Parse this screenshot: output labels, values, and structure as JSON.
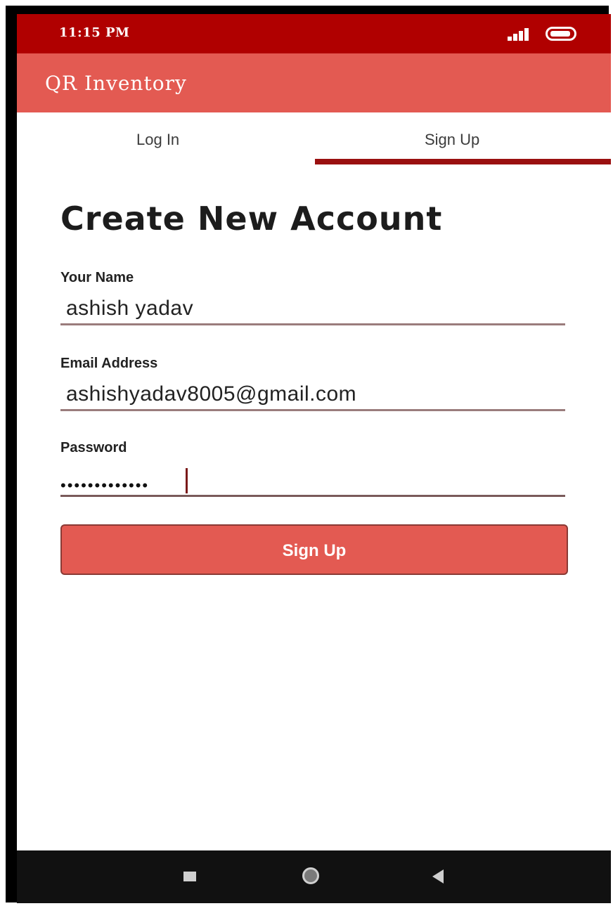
{
  "status_bar": {
    "time": "11:15 PM"
  },
  "app_bar": {
    "title": "QR Inventory"
  },
  "tabs": [
    {
      "label": "Log In",
      "selected": false
    },
    {
      "label": "Sign Up",
      "selected": true
    }
  ],
  "form": {
    "heading": "Create New Account",
    "name_label": "Your Name",
    "name_value": "ashish yadav",
    "email_label": "Email Address",
    "email_value": "ashishyadav8005@gmail.com",
    "password_label": "Password",
    "password_masked": "•••••••••••••",
    "submit_label": "Sign Up"
  },
  "nav_bar": {
    "icons": [
      "recents-icon",
      "home-icon",
      "back-icon"
    ]
  },
  "colors": {
    "status_bar": "#b00000",
    "accent": "#e35a52",
    "tab_indicator": "#9a1010"
  }
}
